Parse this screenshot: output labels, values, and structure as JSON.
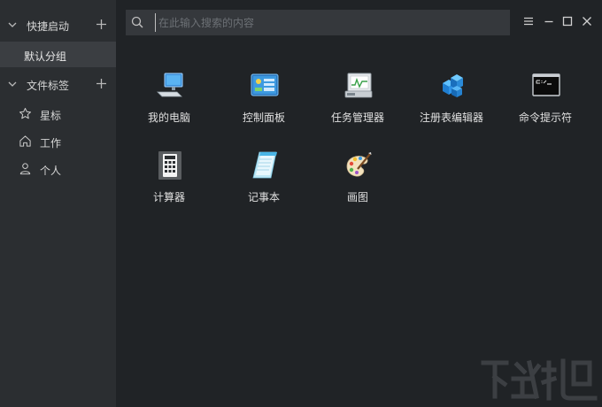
{
  "sidebar": {
    "quick_launch": {
      "label": "快捷启动",
      "expand_icon": "chevron-down-icon",
      "add_icon": "plus-icon"
    },
    "groups": [
      {
        "label": "默认分组",
        "selected": true
      }
    ],
    "file_tags": {
      "label": "文件标签",
      "expand_icon": "chevron-down-icon",
      "add_icon": "plus-icon"
    },
    "tags": [
      {
        "label": "星标",
        "icon": "star-icon"
      },
      {
        "label": "工作",
        "icon": "home-icon"
      },
      {
        "label": "个人",
        "icon": "user-icon"
      }
    ]
  },
  "search": {
    "placeholder": "在此输入搜索的内容",
    "value": ""
  },
  "window_controls": [
    "menu-icon",
    "minimize-icon",
    "maximize-icon",
    "close-icon"
  ],
  "apps": [
    {
      "label": "我的电脑",
      "icon": "computer-icon"
    },
    {
      "label": "控制面板",
      "icon": "control-panel-icon"
    },
    {
      "label": "任务管理器",
      "icon": "task-manager-icon"
    },
    {
      "label": "注册表编辑器",
      "icon": "registry-editor-icon"
    },
    {
      "label": "命令提示符",
      "icon": "command-prompt-icon"
    },
    {
      "label": "计算器",
      "icon": "calculator-icon"
    },
    {
      "label": "记事本",
      "icon": "notepad-icon"
    },
    {
      "label": "画图",
      "icon": "paint-icon"
    }
  ],
  "colors": {
    "background": "#202326",
    "sidebar": "#2b2e31",
    "selected": "#3b3e42",
    "search_bg": "#35383c",
    "text": "#d8d8d8"
  }
}
